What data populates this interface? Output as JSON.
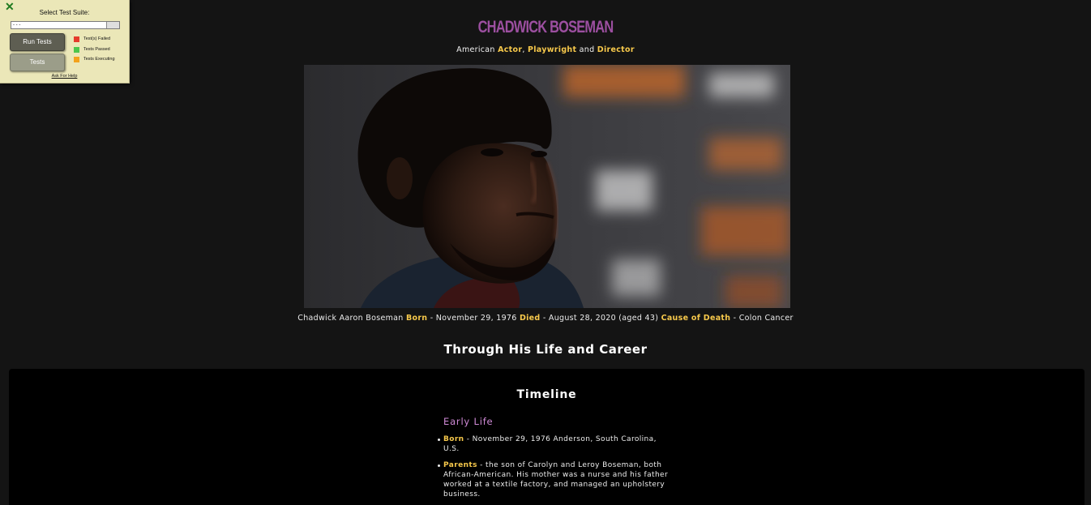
{
  "test_panel": {
    "title": "Select Test Suite:",
    "selected_suite": "- - -",
    "run_button": "Run Tests",
    "tests_button": "Tests",
    "legend": [
      {
        "label": "Test(s) Failed",
        "color": "#e53b2c"
      },
      {
        "label": "Tests Passed",
        "color": "#4cc64c"
      },
      {
        "label": "Tests Executing",
        "color": "#f3a21c"
      }
    ],
    "help_link": "Ask For Help"
  },
  "header": {
    "title": "CHADWICK BOSEMAN",
    "subtitle": {
      "prefix": "American",
      "role1": "Actor",
      "sep1": ",",
      "role2": "Playwright",
      "and": "and",
      "role3": "Director"
    }
  },
  "hero_image": {
    "alt": "Chadwick Boseman portrait"
  },
  "caption": {
    "name": "Chadwick Aaron Boseman",
    "born_label": "Born",
    "born_value": "- November 29, 1976",
    "died_label": "Died",
    "died_value": "- August 28, 2020 (aged 43)",
    "cause_label": "Cause of Death",
    "cause_value": "- Colon Cancer"
  },
  "section_heading": "Through His Life and Career",
  "timeline": {
    "heading": "Timeline",
    "subheading": "Early Life",
    "items": [
      {
        "label": "Born",
        "text": "- November 29, 1976 Anderson, South Carolina, U.S."
      },
      {
        "label": "Parents",
        "text": "- the son of Carolyn and Leroy Boseman, both African-American. His mother was a nurse and his father worked at a textile factory, and managed an upholstery business."
      }
    ]
  },
  "colors": {
    "background": "#141414",
    "title": "#9c4fa0",
    "highlight": "#f6c84b",
    "subheading": "#cf8ad6",
    "panel": "#ebe7b8"
  }
}
